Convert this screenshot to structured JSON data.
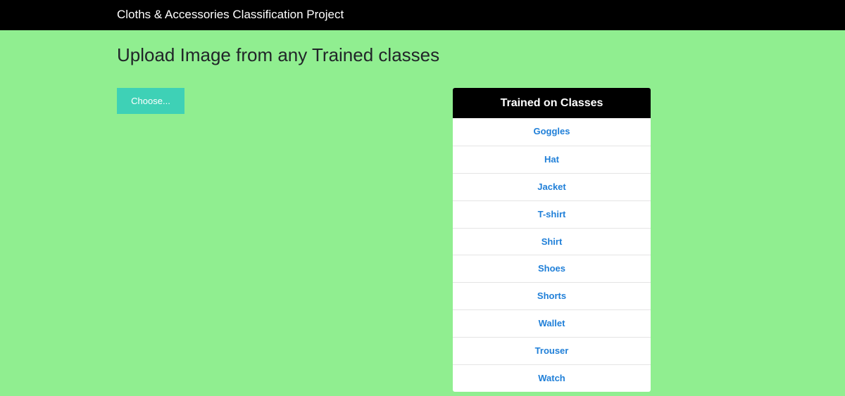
{
  "navbar": {
    "brand": "Cloths & Accessories Classification Project"
  },
  "main": {
    "title": "Upload Image from any Trained classes",
    "choose_label": "Choose..."
  },
  "classes_panel": {
    "header": "Trained on Classes",
    "items": [
      "Goggles",
      "Hat",
      "Jacket",
      "T-shirt",
      "Shirt",
      "Shoes",
      "Shorts",
      "Wallet",
      "Trouser",
      "Watch"
    ]
  },
  "colors": {
    "page_background": "#90ee90",
    "navbar_background": "#000000",
    "button_background": "#3ed1b6",
    "link_color": "#1f7fd8"
  }
}
